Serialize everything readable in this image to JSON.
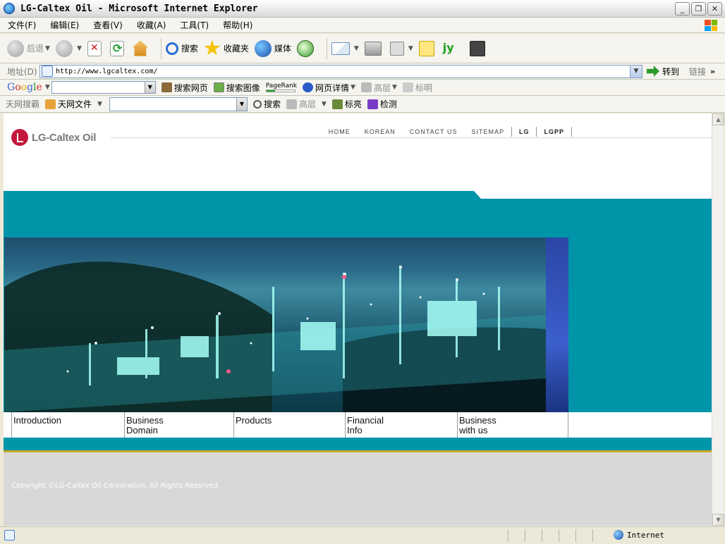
{
  "window": {
    "title": "LG-Caltex Oil - Microsoft Internet Explorer",
    "buttons": [
      "_",
      "❐",
      "✕"
    ]
  },
  "menu": [
    "文件(F)",
    "编辑(E)",
    "查看(V)",
    "收藏(A)",
    "工具(T)",
    "帮助(H)"
  ],
  "toolbar": {
    "back": "后退",
    "search": "搜索",
    "favorites": "收藏夹",
    "media": "媒体"
  },
  "address": {
    "label": "地址(D)",
    "url": "http://www.lgcaltex.com/",
    "go": "转到",
    "links": "链接"
  },
  "googlebar": {
    "search_web": "搜索网页",
    "search_images": "搜索图像",
    "pagerank": "PageRank",
    "page_info": "网页详情",
    "highlight": "高层",
    "mark": "标明"
  },
  "tianwang": {
    "label": "天网搜霸",
    "files": "天网文件",
    "search": "搜索",
    "highlight": "高层",
    "bright": "标亮",
    "check": "检测"
  },
  "page": {
    "logo_text": "LG-Caltex Oil",
    "topnav": [
      "HOME",
      "KOREAN",
      "CONTACT US",
      "SITEMAP",
      "LG",
      "LGPP"
    ],
    "subnav": [
      {
        "line1": "Introduction",
        "line2": ""
      },
      {
        "line1": "Business",
        "line2": "Domain"
      },
      {
        "line1": "Products",
        "line2": ""
      },
      {
        "line1": "Financial",
        "line2": "Info"
      },
      {
        "line1": "Business",
        "line2": "with us"
      }
    ],
    "copyright": "Copyright ©LG-Caltex Oil Corporation. All Rights Reserved."
  },
  "status": {
    "zone": "Internet"
  },
  "colors": {
    "brand_red": "#c4173d",
    "teal": "#0094a8",
    "hero_strip": "#3b5fcc",
    "footer": "#d8d8d8"
  }
}
